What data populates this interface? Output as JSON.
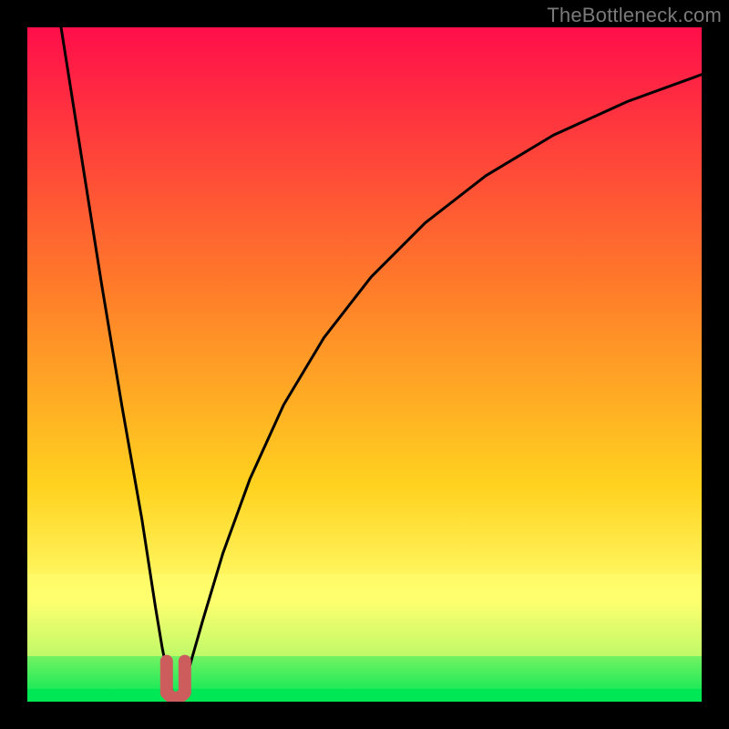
{
  "watermark": "TheBottleneck.com",
  "chart_data": {
    "type": "line",
    "title": "",
    "xlabel": "",
    "ylabel": "",
    "xlim": [
      0,
      100
    ],
    "ylim": [
      0,
      100
    ],
    "optimum_x": 22,
    "series": [
      {
        "name": "curve",
        "x": [
          5,
          8,
          11,
          14,
          17,
          19,
          20,
          21,
          22,
          23,
          24,
          26,
          29,
          33,
          38,
          44,
          51,
          59,
          68,
          78,
          89,
          100
        ],
        "values": [
          100,
          81,
          62,
          44,
          27,
          14,
          8,
          3,
          0,
          2,
          5,
          12,
          22,
          33,
          44,
          54,
          63,
          71,
          78,
          84,
          89,
          93
        ]
      }
    ],
    "marker": {
      "x": 22,
      "y_top": 6,
      "y_bottom": 0,
      "shape": "U"
    },
    "gradient": {
      "orientation": "vertical",
      "top_color": "#ff0e4a",
      "mid1_color": "#ff7a2a",
      "mid2_color": "#ffd21f",
      "band_color": "#ffff6f",
      "bottom_color": "#00e756"
    }
  }
}
